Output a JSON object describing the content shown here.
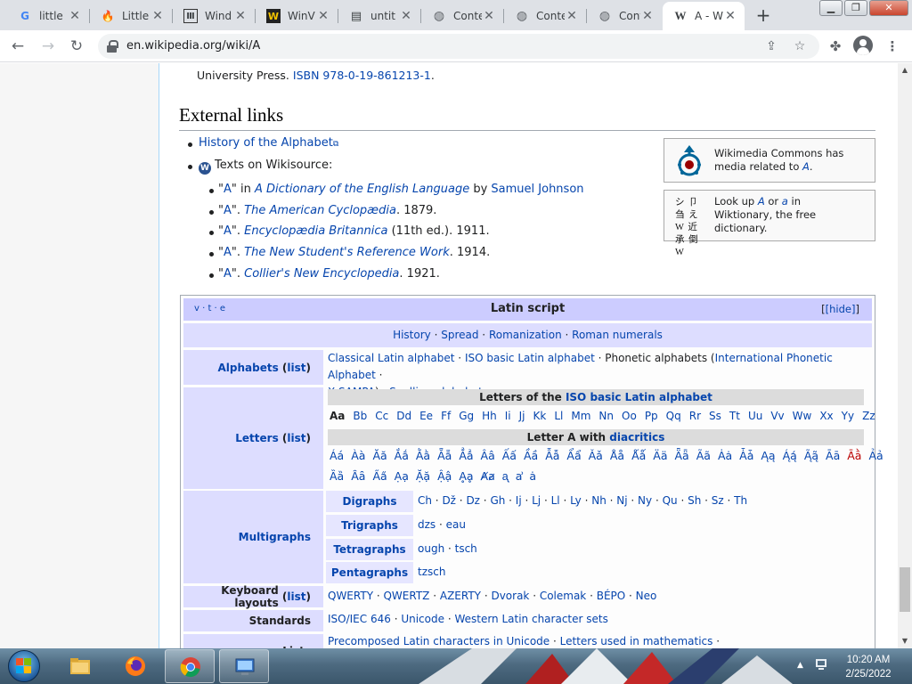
{
  "browser": {
    "tabs": [
      {
        "icon": "google-icon",
        "title": "little"
      },
      {
        "icon": "tinder-icon",
        "title": "Little"
      },
      {
        "icon": "wikipedia-icon",
        "title": "Wind"
      },
      {
        "icon": "wordreference-icon",
        "title": "WinV"
      },
      {
        "icon": "document-icon",
        "title": "untit"
      },
      {
        "icon": "globe-icon",
        "title": "Conte"
      },
      {
        "icon": "globe-icon",
        "title": "Conte"
      },
      {
        "icon": "globe-icon",
        "title": "Conte"
      },
      {
        "icon": "wikipedia-icon",
        "title": "A - W"
      }
    ],
    "url": "en.wikipedia.org/wiki/A"
  },
  "article": {
    "ref_line": {
      "text": "University Press.",
      "isbn_link": "ISBN 978-0-19-861213-1",
      "end": "."
    },
    "section_heading": "External links",
    "links": {
      "history": "History of the Alphabet",
      "wikisource": "Texts on Wikisource:",
      "sub": [
        {
          "q1": "\"",
          "link": "A",
          "q2": "\" in ",
          "work": "A Dictionary of the English Language",
          "by": " by ",
          "author": "Samuel Johnson"
        },
        {
          "q1": "\"",
          "link": "A",
          "q2": "\". ",
          "work": "The American Cyclopædia",
          "tail": ". 1879."
        },
        {
          "q1": "\"",
          "link": "A",
          "q2": "\". ",
          "work": "Encyclopædia Britannica",
          "tail": " (11th ed.). 1911."
        },
        {
          "q1": "\"",
          "link": "A",
          "q2": "\". ",
          "work": "The New Student's Reference Work",
          "tail": ". 1914."
        },
        {
          "q1": "\"",
          "link": "A",
          "q2": "\". ",
          "work": "Collier's New Encyclopedia",
          "tail": ". 1921."
        }
      ]
    },
    "commons": {
      "line1": "Wikimedia Commons has",
      "line2a": "media related to ",
      "line2link": "A",
      "line2b": "."
    },
    "wiktionary": {
      "line1a": "Look up ",
      "a1": "A",
      "or": " or ",
      "a2": "a",
      "in": " in",
      "line2": "Wiktionary, the free",
      "line3": "dictionary.",
      "logo": "シ 卩 刍  え W 近 承 倒 W"
    }
  },
  "navbox": {
    "vte": "v · t · e",
    "title": "Latin script",
    "hide": "[hide]",
    "above": [
      "History",
      "Spread",
      "Romanization",
      "Roman numerals"
    ],
    "rows": {
      "alphabets": {
        "label": "Alphabets",
        "list": "list"
      },
      "letters": {
        "label": "Letters",
        "list": "list"
      },
      "multigraphs": {
        "label": "Multigraphs"
      },
      "keyboard": {
        "label": "Keyboard layouts",
        "list": "list"
      },
      "standards": {
        "label": "Standards"
      },
      "lists": {
        "label": "Lists"
      }
    },
    "alphabets": {
      "a": "Classical Latin alphabet",
      "b": "ISO basic Latin alphabet",
      "c": "Phonetic alphabets (",
      "d": "International Phonetic Alphabet",
      "e": "X-SAMPA",
      "f": "Spelling alphabet"
    },
    "letters_hdr_a": "Letters of the ",
    "letters_hdr_link": "ISO basic Latin alphabet",
    "letters": [
      "Aa",
      "Bb",
      "Cc",
      "Dd",
      "Ee",
      "Ff",
      "Gg",
      "Hh",
      "Ii",
      "Jj",
      "Kk",
      "Ll",
      "Mm",
      "Nn",
      "Oo",
      "Pp",
      "Qq",
      "Rr",
      "Ss",
      "Tt",
      "Uu",
      "Vv",
      "Ww",
      "Xx",
      "Yy",
      "Zz"
    ],
    "diac_hdr_a": "Letter A with ",
    "diac_hdr_link": "diacritics",
    "diac_row1": [
      "Áá",
      "Àà",
      "Ăă",
      "Ắắ",
      "Ằằ",
      "Ẵẵ",
      "Ẳẳ",
      "Ââ",
      "Ấấ",
      "Ầầ",
      "Ẫẫ",
      "Ẩẩ",
      "Ǎǎ",
      "Åå",
      "Ǻǻ",
      "Ää",
      "Ǟǟ",
      "Ãã",
      "Ȧȧ",
      "Ǡǡ",
      "Ąą",
      "Ą́ą́",
      "Ą̃ą̃",
      "Āā",
      "Ā̀ā̀",
      "Ảả"
    ],
    "diac_row2": [
      "Ȁȁ",
      "Ȃȃ",
      "A̋a̋",
      "Ạạ",
      "Ặặ",
      "Ậậ",
      "Ḁḁ",
      "Ⱥⱥ",
      "ᶏ",
      "ẚ",
      "ȧ"
    ],
    "multi": {
      "digraphs_label": "Digraphs",
      "digraphs": [
        "Ch",
        "Dž",
        "Dz",
        "Gh",
        "Ij",
        "Lj",
        "Ll",
        "Ly",
        "Nh",
        "Nj",
        "Ny",
        "Qu",
        "Sh",
        "Sz",
        "Th"
      ],
      "trigraphs_label": "Trigraphs",
      "trigraphs": [
        "dzs",
        "eau"
      ],
      "tetragraphs_label": "Tetragraphs",
      "tetragraphs": [
        "ough",
        "tsch"
      ],
      "pentagraphs_label": "Pentagraphs",
      "pentagraphs": [
        "tzsch"
      ]
    },
    "keyboard": [
      "QWERTY",
      "QWERTZ",
      "AZERTY",
      "Dvorak",
      "Colemak",
      "BÉPO",
      "Neo"
    ],
    "standards": [
      "ISO/IEC 646",
      "Unicode",
      "Western Latin character sets"
    ],
    "lists": [
      "Precomposed Latin characters in Unicode",
      "Letters used in mathematics"
    ]
  },
  "taskbar": {
    "time": "10:20 AM",
    "date": "2/25/2022"
  }
}
